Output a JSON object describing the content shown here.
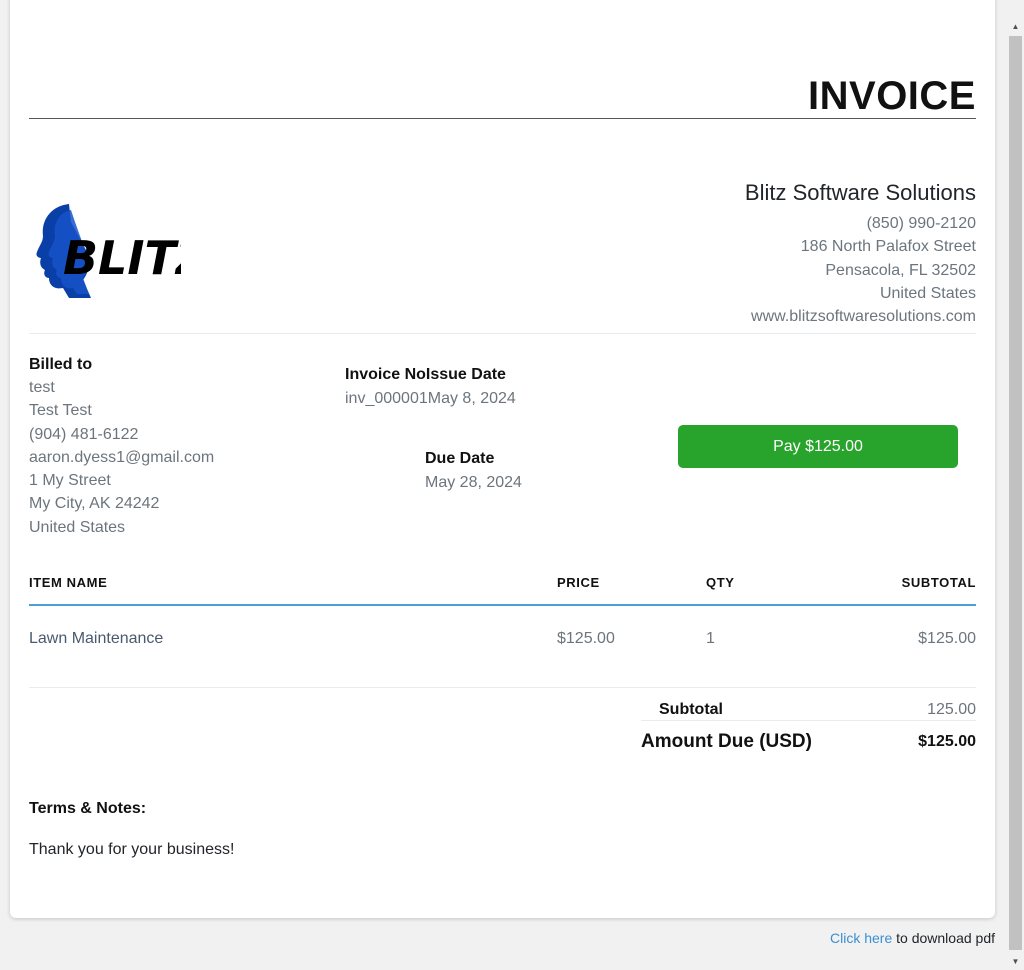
{
  "invoice": {
    "title": "INVOICE"
  },
  "company": {
    "logo_text": "BLITZ",
    "name": "Blitz Software Solutions",
    "phone": "(850) 990-2120",
    "street": "186 North Palafox Street",
    "city": "Pensacola, FL 32502",
    "country": "United States",
    "website": "www.blitzsoftwaresolutions.com"
  },
  "billed_to": {
    "label": "Billed to",
    "lines": [
      "test",
      "Test Test",
      "(904) 481-6122",
      "aaron.dyess1@gmail.com",
      "1 My Street",
      "My City, AK 24242",
      "United States"
    ]
  },
  "meta": {
    "invoice_no_label": "Invoice No",
    "issue_date_label": "Issue Date",
    "invoice_no": "inv_000001",
    "issue_date": "May 8, 2024",
    "due_date_label": "Due Date",
    "due_date": "May 28, 2024"
  },
  "pay_button": {
    "label": "Pay $125.00",
    "color": "#28a32c"
  },
  "table": {
    "headers": {
      "item": "ITEM NAME",
      "price": "PRICE",
      "qty": "QTY",
      "subtotal": "SUBTOTAL"
    },
    "rows": [
      {
        "item": "Lawn Maintenance",
        "price": "$125.00",
        "qty": "1",
        "subtotal": "$125.00"
      }
    ],
    "accent_color": "#4a9fd5"
  },
  "totals": {
    "subtotal_label": "Subtotal",
    "subtotal_value": "125.00",
    "amount_due_label": "Amount Due (USD)",
    "amount_due_value": "$125.00"
  },
  "terms": {
    "label": "Terms & Notes:",
    "text": "Thank you for your business!"
  },
  "footer": {
    "link_text": "Click here",
    "suffix": " to download pdf"
  }
}
